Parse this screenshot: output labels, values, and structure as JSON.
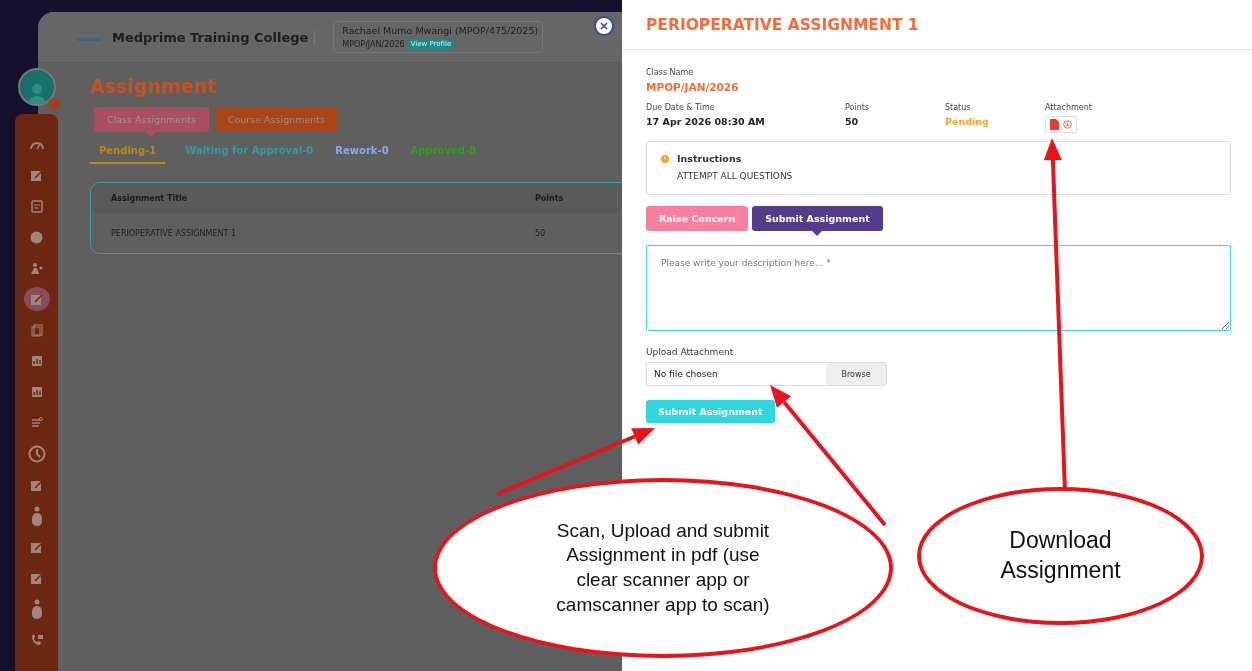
{
  "backdrop": {
    "header": {
      "college": "Medprime Training College",
      "student": "Rachael Mumo Mwangi (MPOP/475/2025)",
      "class": "MPOP/JAN/2026",
      "profile_link": "View Profile"
    },
    "sidebar": {
      "items": [
        {
          "kind": "gauge",
          "selected": false
        },
        {
          "kind": "edit",
          "selected": false
        },
        {
          "kind": "doc",
          "selected": false
        },
        {
          "kind": "coin",
          "selected": false
        },
        {
          "kind": "people",
          "selected": false
        },
        {
          "kind": "edit",
          "selected": true
        },
        {
          "kind": "report",
          "selected": false
        },
        {
          "kind": "chart",
          "selected": false
        },
        {
          "kind": "chart",
          "selected": false
        },
        {
          "kind": "note",
          "selected": false
        },
        {
          "kind": "clock",
          "selected": false
        },
        {
          "kind": "edit",
          "selected": false
        },
        {
          "kind": "person",
          "selected": false
        },
        {
          "kind": "edit",
          "selected": false
        },
        {
          "kind": "edit",
          "selected": false
        },
        {
          "kind": "person",
          "selected": false
        },
        {
          "kind": "phone",
          "selected": false
        }
      ]
    },
    "page_title": "Assignment",
    "assignment_types": [
      {
        "label": "Class Assignments",
        "selected": true
      },
      {
        "label": "Course Assignments",
        "selected": false
      }
    ],
    "status_tabs": [
      {
        "label": "Pending-1",
        "selected": true,
        "color": "#b88a1c"
      },
      {
        "label": "Waiting for Approval-0",
        "selected": false,
        "color": "#2f9ca0"
      },
      {
        "label": "Rework-0",
        "selected": false,
        "color": "#8aa8f0"
      },
      {
        "label": "Approved-0",
        "selected": false,
        "color": "#32a01a"
      }
    ],
    "table": {
      "columns": [
        "Assignment Title",
        "Points"
      ],
      "rows": [
        [
          "PERIOPERATIVE ASSIGNMENT 1",
          "50"
        ]
      ]
    }
  },
  "drawer": {
    "title": "PERIOPERATIVE ASSIGNMENT 1",
    "class_name": {
      "label": "Class Name",
      "value": "MPOP/JAN/2026"
    },
    "details": [
      {
        "label": "Due Date & Time",
        "value": "17 Apr 2026 08:30 AM",
        "kind": "text"
      },
      {
        "label": "Points",
        "value": "50",
        "kind": "text"
      },
      {
        "label": "Status",
        "value": "Pending",
        "kind": "status"
      },
      {
        "label": "Attachment",
        "kind": "attachment"
      }
    ],
    "instructions": {
      "title": "Instructions",
      "text": "ATTEMPT ALL QUESTIONS"
    },
    "actions": [
      {
        "label": "Raise Concern",
        "selected": false
      },
      {
        "label": "Submit Assignment",
        "selected": true
      }
    ],
    "description": {
      "placeholder": "Please write your description here... *"
    },
    "upload": {
      "label": "Upload Attachment",
      "file": "No file chosen",
      "browse": "Browse"
    },
    "submit": "Submit Assignment"
  },
  "annotations": [
    {
      "text": "Scan, Upload and submit Assignment in pdf (use clear scanner app or camscanner app to scan)",
      "kind": "large"
    },
    {
      "text": "Download Assignment",
      "kind": "small"
    }
  ]
}
